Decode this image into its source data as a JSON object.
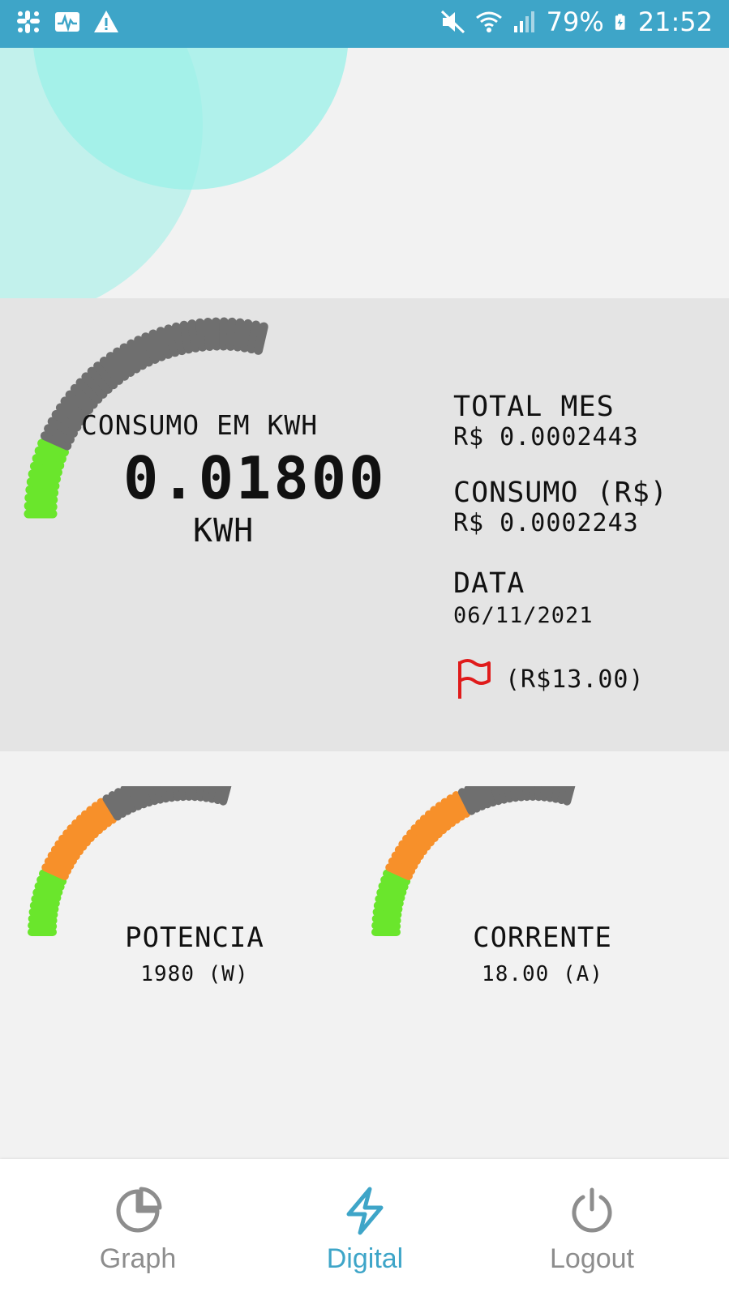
{
  "status_bar": {
    "battery": "79%",
    "time": "21:52",
    "left_icons": [
      "slack-icon",
      "activity-icon",
      "warning-icon"
    ],
    "right_icons": [
      "mute-icon",
      "wifi-icon",
      "signal-icon",
      "battery-charging-icon"
    ]
  },
  "colors": {
    "status_bar": "#3ea5c8",
    "gauge_green": "#6ae62c",
    "gauge_orange": "#f7902a",
    "gauge_gray": "#6f6f6f",
    "flag_red": "#e01b1b",
    "nav_active": "#3ea5c8",
    "nav_inactive": "#8d8d8d",
    "circle_teal": "#9af0e8"
  },
  "consumo": {
    "label": "CONSUMO EM KWH",
    "value": "0.01800",
    "unit": "KWH"
  },
  "info": {
    "total_mes_label": "TOTAL MES",
    "total_mes_value": "R$ 0.0002443",
    "consumo_rs_label": "CONSUMO (R$)",
    "consumo_rs_value": "R$ 0.0002243",
    "data_label": "DATA",
    "data_value": "06/11/2021",
    "flag_value": "(R$13.00)",
    "flag_icon": "flag-icon"
  },
  "potencia": {
    "label": "POTENCIA",
    "value": "1980 (W)"
  },
  "corrente": {
    "label": "CORRENTE",
    "value": "18.00 (A)"
  },
  "nav": {
    "items": [
      {
        "label": "Graph",
        "icon": "pie-chart-icon",
        "active": false
      },
      {
        "label": "Digital",
        "icon": "lightning-icon",
        "active": true
      },
      {
        "label": "Logout",
        "icon": "power-icon",
        "active": false
      }
    ]
  }
}
